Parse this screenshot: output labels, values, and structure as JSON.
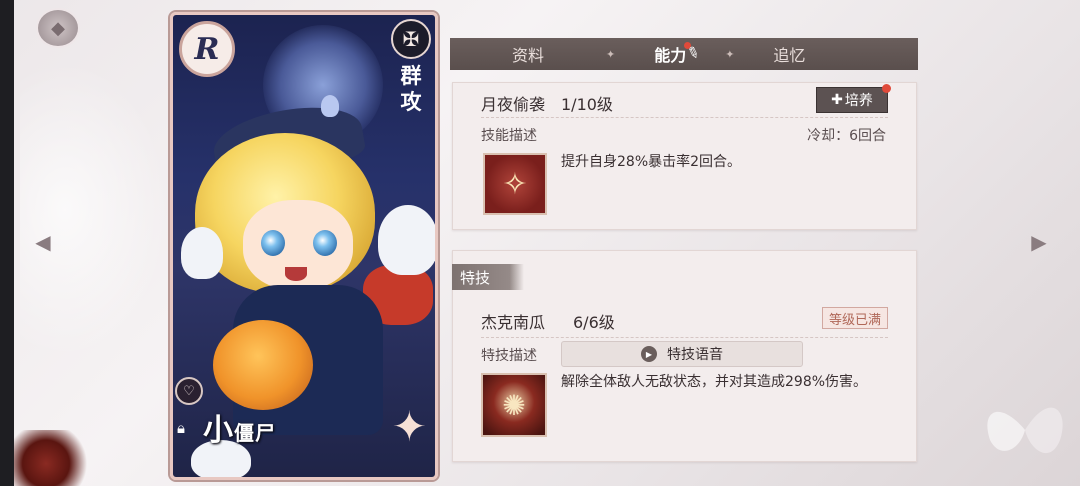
{
  "character": {
    "rarity": "R",
    "attack_type": "群攻",
    "name_prefix": "小",
    "name_main": "僵尸"
  },
  "tabs": [
    {
      "label": "资料",
      "active": false
    },
    {
      "label": "能力",
      "active": true
    },
    {
      "label": "追忆",
      "active": false
    }
  ],
  "skill": {
    "name": "月夜偷袭",
    "level": "1/10级",
    "nurture_label": "培养",
    "desc_label": "技能描述",
    "cooldown": "冷却：6回合",
    "description": "提升自身28%暴击率2回合。"
  },
  "special": {
    "header": "特技",
    "name": "杰克南瓜",
    "level": "6/6级",
    "maxed_label": "等级已满",
    "desc_label": "特技描述",
    "voice_label": "特技语音",
    "description": "解除全体敌人无敌状态，并对其造成298%伤害。"
  },
  "colors": {
    "tabbar": "#5a4f4d",
    "panel": "#f3eded",
    "notify_dot": "#e04a3a",
    "card_bg": "#26316a"
  },
  "icons": [
    "home-icon",
    "left-arrow-icon",
    "right-arrow-icon",
    "pencil-icon",
    "heart-icon",
    "lock-icon",
    "play-icon",
    "plus-icon"
  ]
}
